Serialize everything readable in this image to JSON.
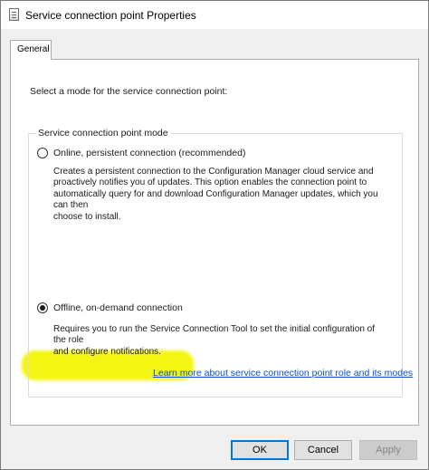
{
  "window": {
    "title": "Service connection point Properties"
  },
  "tabs": [
    {
      "label": "General"
    }
  ],
  "general": {
    "prompt": "Select a mode for the service connection point:",
    "group_title": "Service connection point mode",
    "options": [
      {
        "label": "Online, persistent connection (recommended)",
        "selected": false,
        "description_lines": [
          "Creates a persistent connection to the Configuration Manager cloud service and",
          "proactively notifies you of updates. This option enables the connection point to",
          "automatically query for and download Configuration Manager updates, which you can then",
          "choose to install."
        ]
      },
      {
        "label": "Offline, on-demand connection",
        "selected": true,
        "description_lines": [
          "Requires you to run the Service Connection Tool to set the initial configuration of the role",
          "and configure notifications."
        ]
      }
    ],
    "learn_more_link": "Learn more about service connection point role and its modes"
  },
  "buttons": {
    "ok": "OK",
    "cancel": "Cancel",
    "apply": "Apply"
  },
  "colors": {
    "highlight": "#f5f500",
    "link": "#0a4fd3",
    "default_button_border": "#0078d7"
  },
  "icons": {
    "app": "properties-window-icon"
  }
}
